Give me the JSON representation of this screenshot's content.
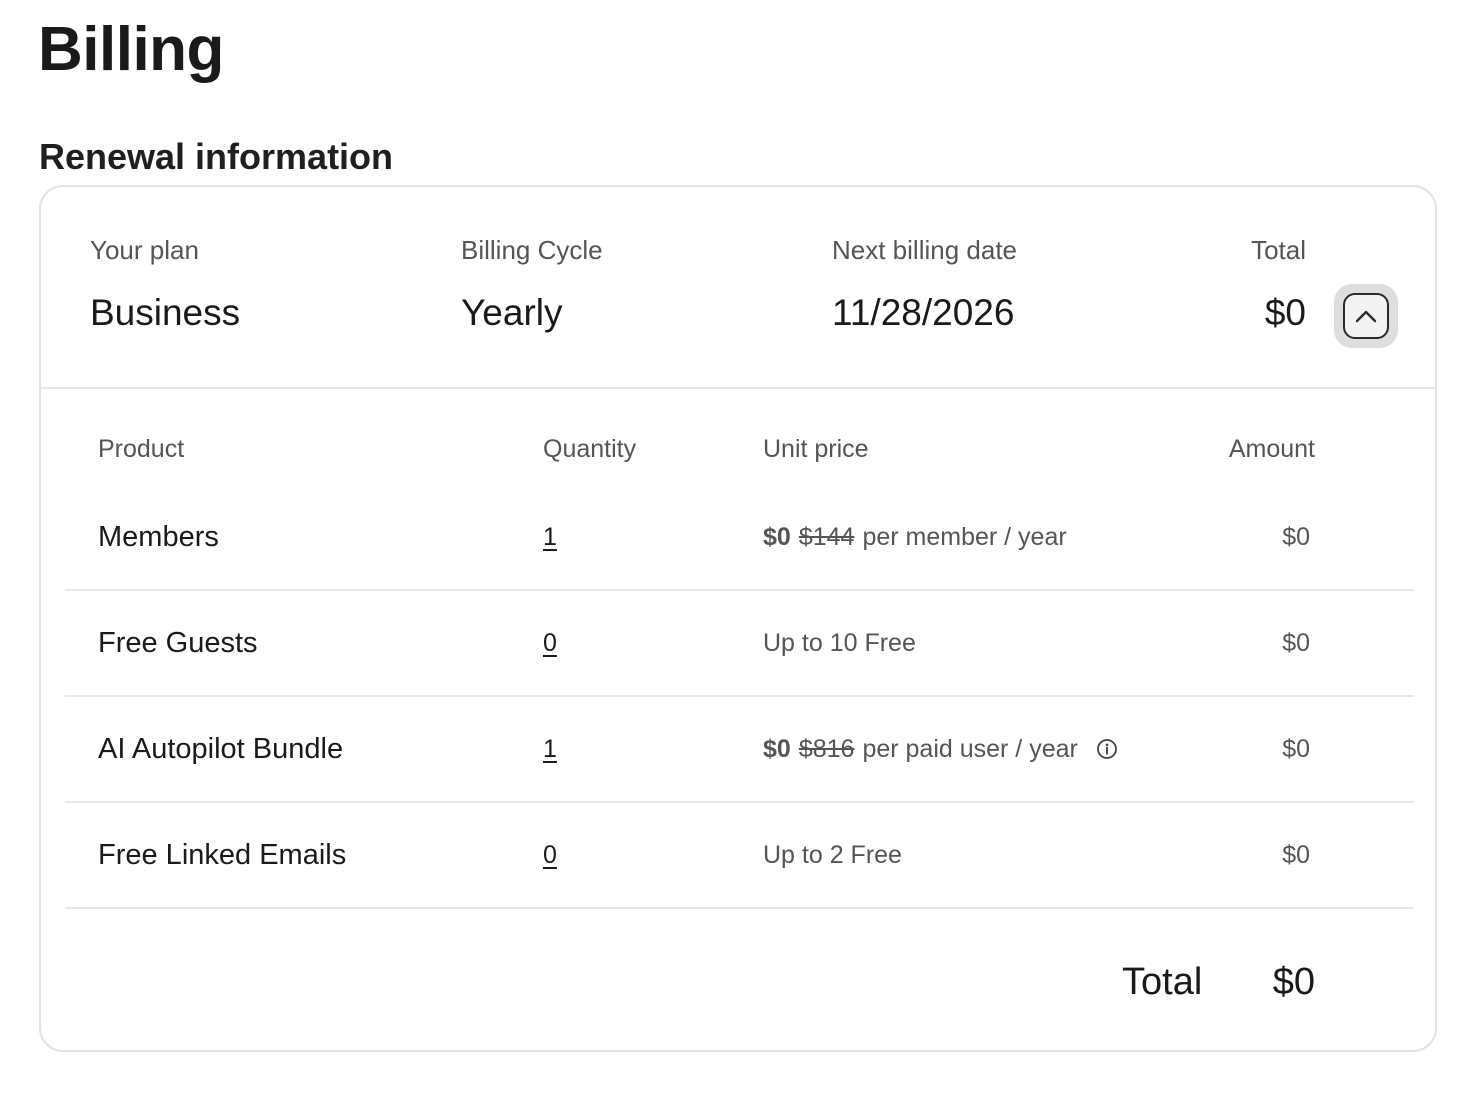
{
  "page": {
    "title": "Billing"
  },
  "renewal": {
    "section_title": "Renewal information",
    "plan_label": "Your plan",
    "plan_value": "Business",
    "cycle_label": "Billing Cycle",
    "cycle_value": "Yearly",
    "next_date_label": "Next billing date",
    "next_date_value": "11/28/2026",
    "total_label": "Total",
    "total_value": "$0",
    "toggle_icon": "chevron-up-icon"
  },
  "table": {
    "headers": {
      "product": "Product",
      "quantity": "Quantity",
      "unit_price": "Unit price",
      "amount": "Amount"
    },
    "rows": [
      {
        "product": "Members",
        "quantity": "1",
        "price_now": "$0",
        "price_old": "$144",
        "price_note": "per member / year",
        "amount": "$0"
      },
      {
        "product": "Free Guests",
        "quantity": "0",
        "price_note": "Up to 10 Free",
        "amount": "$0"
      },
      {
        "product": "AI Autopilot Bundle",
        "quantity": "1",
        "price_now": "$0",
        "price_old": "$816",
        "price_note": "per paid user / year",
        "info_icon": "info-icon",
        "amount": "$0"
      },
      {
        "product": "Free Linked Emails",
        "quantity": "0",
        "price_note": "Up to 2 Free",
        "amount": "$0"
      }
    ],
    "total_label": "Total",
    "total_value": "$0"
  }
}
